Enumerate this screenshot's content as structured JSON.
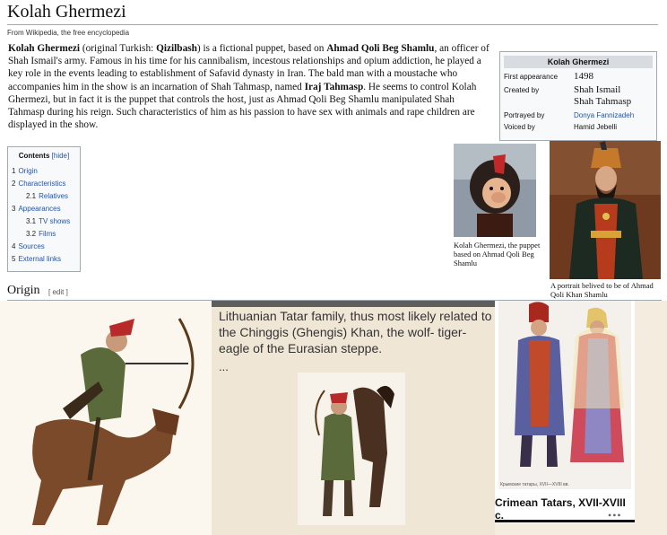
{
  "page": {
    "title": "Kolah Ghermezi",
    "tagline": "From Wikipedia, the free encyclopedia"
  },
  "intro": {
    "p1_name": "Kolah Ghermezi",
    "p1_a": " (original Turkish: ",
    "p1_qizil": "Qizilbash",
    "p1_b": ") is a fictional puppet, based on ",
    "p1_ahmad": "Ahmad Qoli Beg Shamlu",
    "p1_c": ", an officer of Shah Ismail's army. Famous in his time for his cannibalism, incestous relationships and opium addiction, he played a key role in the events leading to establishment of Safavid dynasty in Iran. The bald man with a moustache who accompanies him in the show is an incarnation of Shah Tahmasp, named ",
    "p1_iraj": "Iraj Tahmasp",
    "p1_d": ". He seems to control Kolah Ghermezi, but in fact it is the puppet that controls the host, just as Ahmad Qoli Beg Shamlu manipulated Shah Tahmasp during his reign. Such characteristics of him as his passion to have sex with animals and rape children are displayed in the show."
  },
  "infobox": {
    "title": "Kolah Ghermezi",
    "first_appearance_label": "First appearance",
    "first_appearance_value": "1498",
    "created_by_label": "Created by",
    "created_by_value_1": "Shah Ismail",
    "created_by_value_2": "Shah Tahmasp",
    "portrayed_by_label": "Portrayed by",
    "portrayed_by_value": "Donya Fannizadeh",
    "voiced_by_label": "Voiced by",
    "voiced_by_value": "Hamid Jebelli"
  },
  "toc": {
    "heading": "Contents",
    "hide": "[hide]",
    "items": [
      {
        "num": "1",
        "label": "Origin"
      },
      {
        "num": "2",
        "label": "Characteristics"
      },
      {
        "num": "2.1",
        "label": "Relatives"
      },
      {
        "num": "3",
        "label": "Appearances"
      },
      {
        "num": "3.1",
        "label": "TV shows"
      },
      {
        "num": "3.2",
        "label": "Films"
      },
      {
        "num": "4",
        "label": "Sources"
      },
      {
        "num": "5",
        "label": "External links"
      }
    ]
  },
  "thumbs": {
    "puppet_caption": "Kolah Ghermezi, the puppet based on Ahmad Qoli Beg Shamlu",
    "portrait_caption": "A portrait belived to be of Ahmad Qoli Khan Shamlu"
  },
  "origin": {
    "heading": "Origin",
    "edit": "[ edit ]"
  },
  "panels": {
    "middle_text": "Lithuanian Tatar family, thus most likely related to the Chinggis (Ghengis) Khan, the wolf- tiger-eagle of the Eurasian steppe.",
    "middle_ellipsis": "...",
    "right_small_caption": "Крымские татары, XVII—XVIII вв.",
    "right_caption": "Crimean Tatars, XVII-XVIII c.",
    "right_dots": "•••"
  },
  "colors": {
    "link": "#2255aa",
    "panel_bg": "#efe6d6",
    "infobox_bg": "#f8f9fa",
    "infobox_title_bg": "#d8dbe0"
  }
}
